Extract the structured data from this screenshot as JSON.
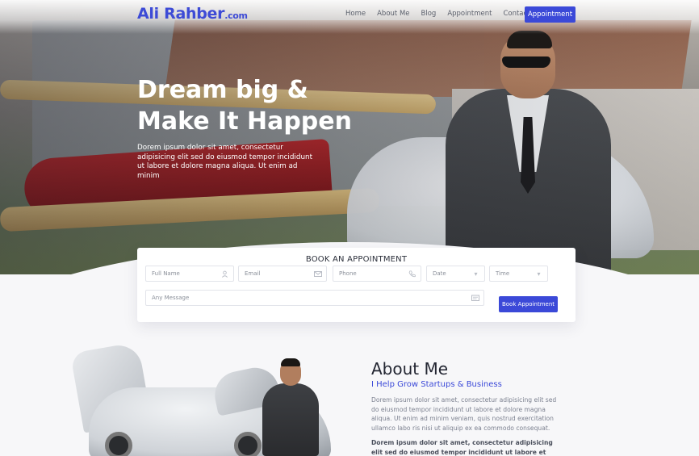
{
  "brand": {
    "name": "Ali Rahber",
    "domain": ".com",
    "accent": "#3b49d8"
  },
  "nav": {
    "links": [
      "Home",
      "About Me",
      "Blog",
      "Appointment",
      "Contact"
    ],
    "cta": "Appointment"
  },
  "hero": {
    "title_line1": "Dream big &",
    "title_line2": "Make It Happen",
    "subtitle": "Dorem ipsum dolor sit amet, consectetur adipisicing elit sed do eiusmod tempor incididunt ut labore et dolore magna aliqua. Ut enim ad minim"
  },
  "booking": {
    "title": "BOOK AN APPOINTMENT",
    "full_name": "Full Name",
    "email": "Email",
    "phone": "Phone",
    "date": "Date",
    "time": "Time",
    "message": "Any Message",
    "submit": "Book Appointment",
    "icons": [
      "user-icon",
      "mail-icon",
      "phone-icon",
      "dropdown-icon",
      "dropdown-icon",
      "message-icon"
    ]
  },
  "about": {
    "title": "About Me",
    "subtitle": "I Help Grow Startups & Business",
    "paragraph1": "Dorem ipsum dolor sit amet, consectetur adipisicing elit sed do eiusmod tempor incididunt ut labore et dolore magna aliqua. Ut enim ad minim veniam, quis nostrud exercitation ullamco labo ris nisi ut aliquip ex ea commodo consequat.",
    "paragraph2": "Dorem ipsum dolor sit amet, consectetur adipisicing elit sed do eiusmod tempor incididunt ut labore et dolore magna aliqua."
  }
}
